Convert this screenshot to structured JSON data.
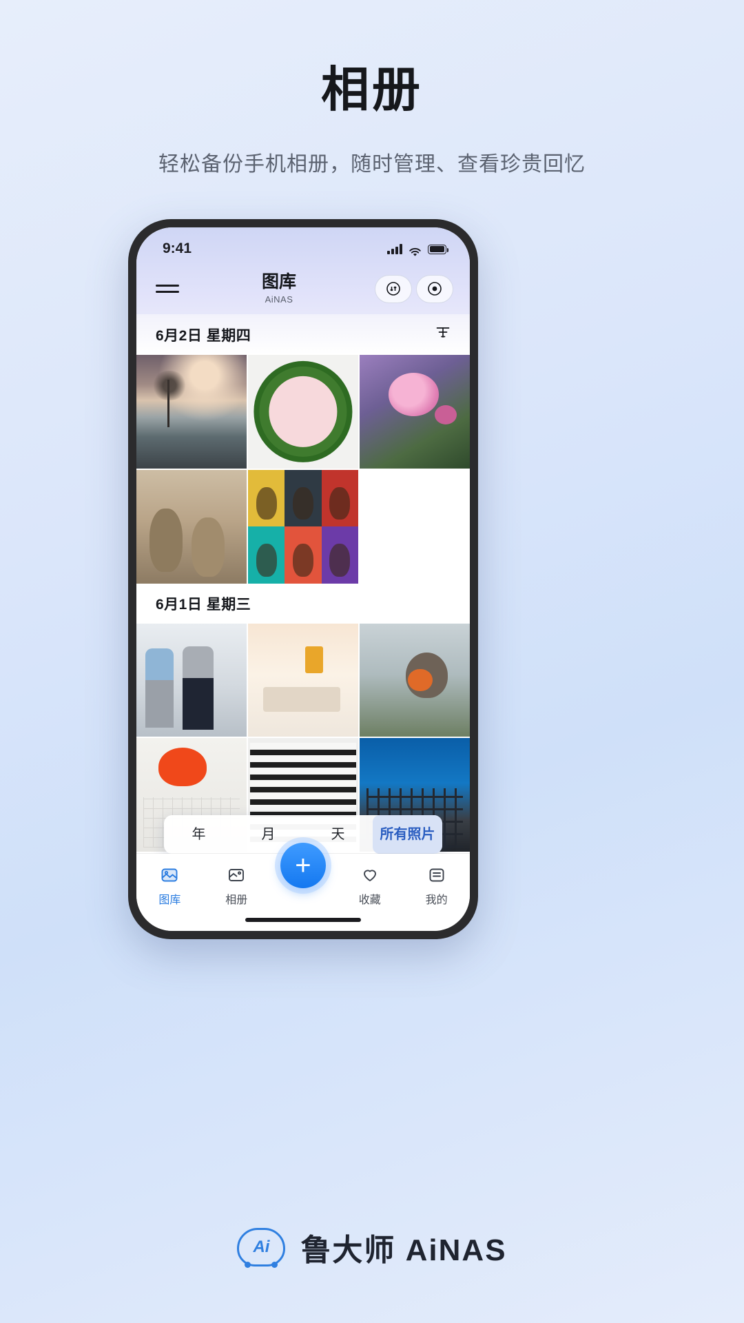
{
  "page": {
    "title": "相册",
    "subtitle": "轻松备份手机相册，随时管理、查看珍贵回忆"
  },
  "phone": {
    "status_bar": {
      "time": "9:41",
      "icons": [
        "signal-bars-icon",
        "wifi-icon",
        "battery-icon"
      ]
    },
    "app_bar": {
      "menu_icon": "hamburger-menu-icon",
      "title": "图库",
      "subtitle": "AiNAS",
      "actions": [
        {
          "icon": "sync-transfer-icon"
        },
        {
          "icon": "record-dot-icon"
        }
      ]
    },
    "sections": [
      {
        "date_label": "6月2日  星期四",
        "filter_icon": "filter-funnel-icon",
        "photos": [
          {
            "name": "lone-tree-lake-photo",
            "art": "ph-lake"
          },
          {
            "name": "pink-circle-leaves-photo",
            "art": "ph-leaf"
          },
          {
            "name": "pink-rose-photo",
            "art": "ph-rose"
          },
          {
            "name": "goats-photo",
            "art": "ph-goat"
          },
          {
            "name": "dog-collage-photo",
            "art": "ph-dogs"
          },
          {
            "name": "empty-slot",
            "art": "blank"
          }
        ]
      },
      {
        "date_label": "6月1日  星期三",
        "photos": [
          {
            "name": "business-meeting-photo",
            "art": "ph-office"
          },
          {
            "name": "desk-workspace-photo",
            "art": "ph-desk"
          },
          {
            "name": "robin-bird-photo",
            "art": "ph-bird"
          },
          {
            "name": "blueprint-helmet-photo",
            "art": "ph-plan"
          },
          {
            "name": "apartment-building-photo",
            "art": "ph-bld"
          },
          {
            "name": "construction-scaffold-photo",
            "art": "ph-scaf"
          }
        ]
      }
    ],
    "segmented_control": {
      "options": [
        "年",
        "月",
        "天",
        "所有照片"
      ],
      "active_index": 3
    },
    "tab_bar": {
      "tabs": [
        {
          "label": "图库",
          "icon": "photo-library-icon",
          "active": true
        },
        {
          "label": "相册",
          "icon": "albums-icon",
          "active": false
        },
        {
          "label": "收藏",
          "icon": "heart-icon",
          "active": false
        },
        {
          "label": "我的",
          "icon": "profile-list-icon",
          "active": false
        }
      ],
      "fab_label": "+",
      "fab_icon": "add-plus-icon"
    }
  },
  "footer": {
    "logo_mark": "Ai",
    "brand": "鲁大师 AiNAS"
  },
  "colors": {
    "accent": "#2a7ce0",
    "fab": "#1478f0",
    "segment_active_bg": "#d8e2f6",
    "segment_active_text": "#2a5dc0",
    "brand": "#2f7fe0"
  }
}
